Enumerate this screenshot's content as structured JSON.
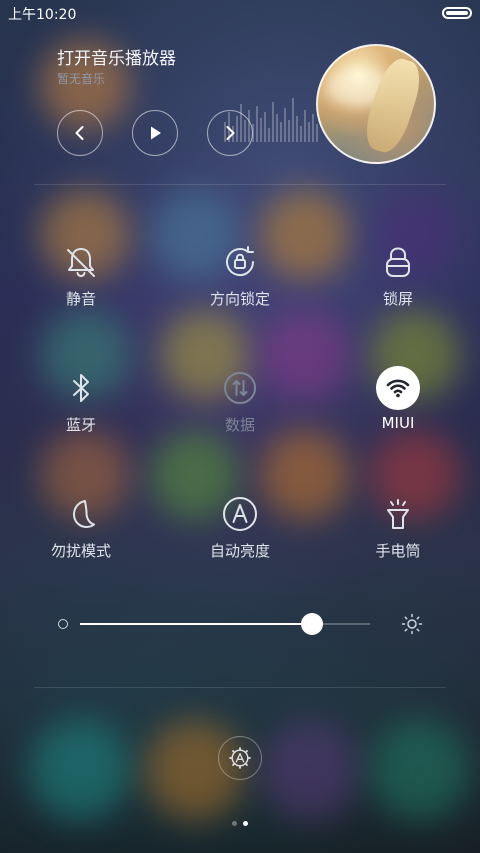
{
  "status_bar": {
    "time": "上午10:20"
  },
  "music": {
    "title": "打开音乐播放器",
    "subtitle": "暂无音乐",
    "controls": {
      "prev": "chevron-left-icon",
      "play": "play-icon",
      "next": "chevron-right-icon"
    }
  },
  "toggles": [
    {
      "label": "静音",
      "icon": "bell-off-icon",
      "state": "normal"
    },
    {
      "label": "方向锁定",
      "icon": "rotation-lock-icon",
      "state": "normal"
    },
    {
      "label": "锁屏",
      "icon": "lock-icon",
      "state": "normal"
    },
    {
      "label": "蓝牙",
      "icon": "bluetooth-icon",
      "state": "normal"
    },
    {
      "label": "数据",
      "icon": "mobile-data-icon",
      "state": "disabled"
    },
    {
      "label": "MIUI",
      "icon": "wifi-icon",
      "state": "active"
    },
    {
      "label": "勿扰模式",
      "icon": "moon-icon",
      "state": "normal"
    },
    {
      "label": "自动亮度",
      "icon": "auto-brightness-icon",
      "state": "normal"
    },
    {
      "label": "手电筒",
      "icon": "flashlight-icon",
      "state": "normal"
    }
  ],
  "brightness": {
    "level": 0.8
  },
  "pager": {
    "pages": 2,
    "current": 2
  },
  "colors": {
    "accent": "#ffffff",
    "label": "#dfe3ea",
    "disabled": "#7d8597"
  }
}
